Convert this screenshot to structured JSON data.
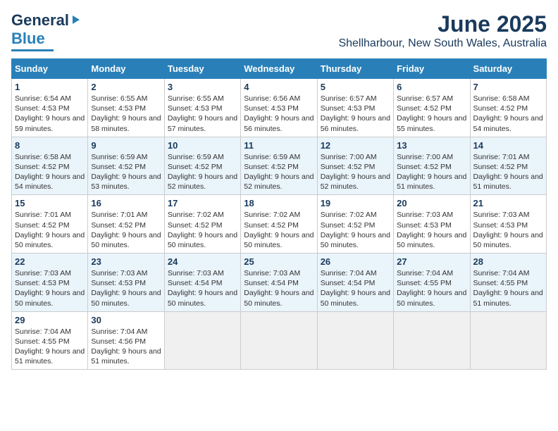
{
  "header": {
    "logo_general": "General",
    "logo_blue": "Blue",
    "month_title": "June 2025",
    "location": "Shellharbour, New South Wales, Australia"
  },
  "days_of_week": [
    "Sunday",
    "Monday",
    "Tuesday",
    "Wednesday",
    "Thursday",
    "Friday",
    "Saturday"
  ],
  "weeks": [
    [
      {
        "day": "1",
        "sunrise": "6:54 AM",
        "sunset": "4:53 PM",
        "daylight": "9 hours and 59 minutes."
      },
      {
        "day": "2",
        "sunrise": "6:55 AM",
        "sunset": "4:53 PM",
        "daylight": "9 hours and 58 minutes."
      },
      {
        "day": "3",
        "sunrise": "6:55 AM",
        "sunset": "4:53 PM",
        "daylight": "9 hours and 57 minutes."
      },
      {
        "day": "4",
        "sunrise": "6:56 AM",
        "sunset": "4:53 PM",
        "daylight": "9 hours and 56 minutes."
      },
      {
        "day": "5",
        "sunrise": "6:57 AM",
        "sunset": "4:53 PM",
        "daylight": "9 hours and 56 minutes."
      },
      {
        "day": "6",
        "sunrise": "6:57 AM",
        "sunset": "4:52 PM",
        "daylight": "9 hours and 55 minutes."
      },
      {
        "day": "7",
        "sunrise": "6:58 AM",
        "sunset": "4:52 PM",
        "daylight": "9 hours and 54 minutes."
      }
    ],
    [
      {
        "day": "8",
        "sunrise": "6:58 AM",
        "sunset": "4:52 PM",
        "daylight": "9 hours and 54 minutes."
      },
      {
        "day": "9",
        "sunrise": "6:59 AM",
        "sunset": "4:52 PM",
        "daylight": "9 hours and 53 minutes."
      },
      {
        "day": "10",
        "sunrise": "6:59 AM",
        "sunset": "4:52 PM",
        "daylight": "9 hours and 52 minutes."
      },
      {
        "day": "11",
        "sunrise": "6:59 AM",
        "sunset": "4:52 PM",
        "daylight": "9 hours and 52 minutes."
      },
      {
        "day": "12",
        "sunrise": "7:00 AM",
        "sunset": "4:52 PM",
        "daylight": "9 hours and 52 minutes."
      },
      {
        "day": "13",
        "sunrise": "7:00 AM",
        "sunset": "4:52 PM",
        "daylight": "9 hours and 51 minutes."
      },
      {
        "day": "14",
        "sunrise": "7:01 AM",
        "sunset": "4:52 PM",
        "daylight": "9 hours and 51 minutes."
      }
    ],
    [
      {
        "day": "15",
        "sunrise": "7:01 AM",
        "sunset": "4:52 PM",
        "daylight": "9 hours and 50 minutes."
      },
      {
        "day": "16",
        "sunrise": "7:01 AM",
        "sunset": "4:52 PM",
        "daylight": "9 hours and 50 minutes."
      },
      {
        "day": "17",
        "sunrise": "7:02 AM",
        "sunset": "4:52 PM",
        "daylight": "9 hours and 50 minutes."
      },
      {
        "day": "18",
        "sunrise": "7:02 AM",
        "sunset": "4:52 PM",
        "daylight": "9 hours and 50 minutes."
      },
      {
        "day": "19",
        "sunrise": "7:02 AM",
        "sunset": "4:52 PM",
        "daylight": "9 hours and 50 minutes."
      },
      {
        "day": "20",
        "sunrise": "7:03 AM",
        "sunset": "4:53 PM",
        "daylight": "9 hours and 50 minutes."
      },
      {
        "day": "21",
        "sunrise": "7:03 AM",
        "sunset": "4:53 PM",
        "daylight": "9 hours and 50 minutes."
      }
    ],
    [
      {
        "day": "22",
        "sunrise": "7:03 AM",
        "sunset": "4:53 PM",
        "daylight": "9 hours and 50 minutes."
      },
      {
        "day": "23",
        "sunrise": "7:03 AM",
        "sunset": "4:53 PM",
        "daylight": "9 hours and 50 minutes."
      },
      {
        "day": "24",
        "sunrise": "7:03 AM",
        "sunset": "4:54 PM",
        "daylight": "9 hours and 50 minutes."
      },
      {
        "day": "25",
        "sunrise": "7:03 AM",
        "sunset": "4:54 PM",
        "daylight": "9 hours and 50 minutes."
      },
      {
        "day": "26",
        "sunrise": "7:04 AM",
        "sunset": "4:54 PM",
        "daylight": "9 hours and 50 minutes."
      },
      {
        "day": "27",
        "sunrise": "7:04 AM",
        "sunset": "4:55 PM",
        "daylight": "9 hours and 50 minutes."
      },
      {
        "day": "28",
        "sunrise": "7:04 AM",
        "sunset": "4:55 PM",
        "daylight": "9 hours and 51 minutes."
      }
    ],
    [
      {
        "day": "29",
        "sunrise": "7:04 AM",
        "sunset": "4:55 PM",
        "daylight": "9 hours and 51 minutes."
      },
      {
        "day": "30",
        "sunrise": "7:04 AM",
        "sunset": "4:56 PM",
        "daylight": "9 hours and 51 minutes."
      },
      null,
      null,
      null,
      null,
      null
    ]
  ],
  "labels": {
    "sunrise": "Sunrise:",
    "sunset": "Sunset:",
    "daylight": "Daylight:"
  }
}
